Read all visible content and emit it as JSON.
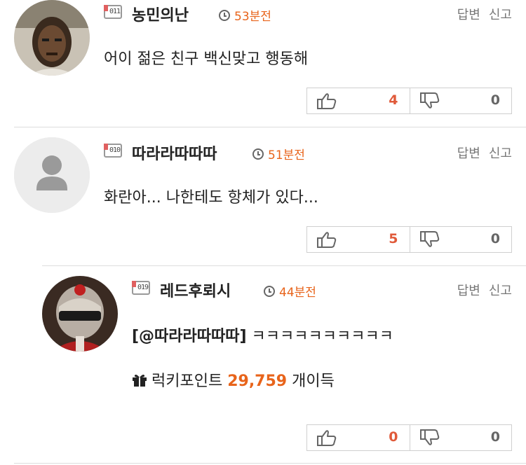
{
  "comments": [
    {
      "level": "011",
      "nickname": "농민의난",
      "time": "53분전",
      "reply_label": "답변",
      "report_label": "신고",
      "text": "어이 젊은 친구 백신맞고 행동해",
      "upvotes": "4",
      "downvotes": "0"
    },
    {
      "level": "010",
      "nickname": "따라라따따따",
      "time": "51분전",
      "reply_label": "답변",
      "report_label": "신고",
      "text": "화란아...  나한테도 항체가 있다...",
      "upvotes": "5",
      "downvotes": "0"
    },
    {
      "level": "019",
      "nickname": "레드후뢰시",
      "time": "44분전",
      "reply_label": "답변",
      "report_label": "신고",
      "mention": "[@따라라따따따]",
      "text": " ㅋㅋㅋㅋㅋㅋㅋㅋㅋㅋ",
      "lucky_label": "럭키포인트",
      "lucky_points": "29,759",
      "lucky_suffix": "개이득",
      "upvotes": "0",
      "downvotes": "0"
    }
  ],
  "icons": [
    "clock-icon",
    "thumbs-up-icon",
    "thumbs-down-icon",
    "gift-icon",
    "default-user-icon"
  ],
  "colors": {
    "accent": "#e8641b",
    "upvote": "#e05a3a",
    "text": "#222222",
    "muted": "#777777"
  }
}
